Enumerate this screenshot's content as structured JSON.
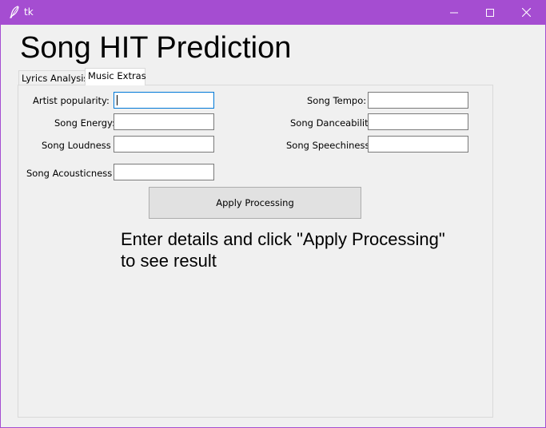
{
  "window": {
    "title": "tk",
    "controls": {
      "minimize": "minimize-icon",
      "maximize": "maximize-icon",
      "close": "close-icon"
    },
    "accent_color": "#a54dd1"
  },
  "app": {
    "heading": "Song HIT Prediction"
  },
  "tabs": [
    {
      "label": "Lyrics Analysis",
      "selected": false
    },
    {
      "label": "Music Extras",
      "selected": true
    }
  ],
  "form": {
    "left": [
      {
        "label": "Artist popularity:",
        "value": ""
      },
      {
        "label": "Song Energy:",
        "value": ""
      },
      {
        "label": "Song Loudness",
        "value": ""
      },
      {
        "label": "Song Acousticness",
        "value": ""
      }
    ],
    "right": [
      {
        "label": "Song Tempo:",
        "value": ""
      },
      {
        "label": "Song Danceability",
        "value": ""
      },
      {
        "label": "Song Speechiness:",
        "value": ""
      }
    ]
  },
  "apply_button": {
    "label": "Apply Processing"
  },
  "result": {
    "line1": "Enter details and click \"Apply Processing\"",
    "line2": "to see result"
  }
}
